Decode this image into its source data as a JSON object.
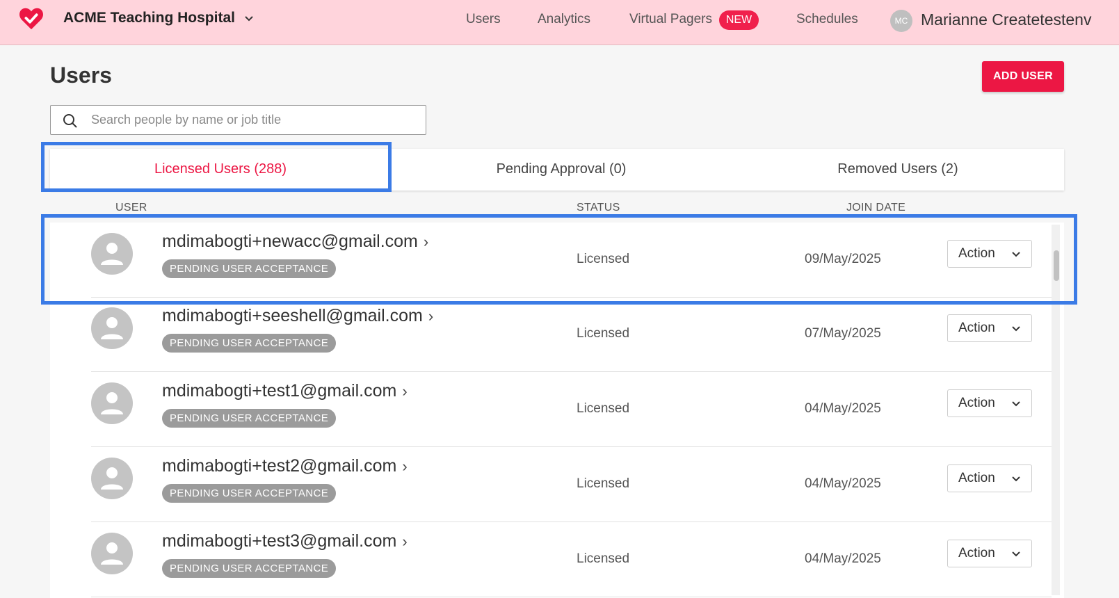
{
  "header": {
    "org_name": "ACME Teaching Hospital",
    "nav": [
      {
        "label": "Users"
      },
      {
        "label": "Analytics"
      },
      {
        "label": "Virtual Pagers",
        "badge": "NEW"
      },
      {
        "label": "Schedules"
      }
    ],
    "user_initials": "MC",
    "user_name": "Marianne Createtestenv"
  },
  "page": {
    "title": "Users",
    "add_user_label": "ADD USER",
    "search_placeholder": "Search people by name or job title",
    "search_value": ""
  },
  "tabs": [
    {
      "label": "Licensed Users (288)",
      "active": true
    },
    {
      "label": "Pending Approval (0)",
      "active": false
    },
    {
      "label": "Removed Users (2)",
      "active": false
    }
  ],
  "table": {
    "columns": [
      "USER",
      "STATUS",
      "JOIN DATE"
    ],
    "rows": [
      {
        "email": "mdimabogti+newacc@gmail.com",
        "badge": "PENDING USER ACCEPTANCE",
        "status": "Licensed",
        "join_date": "09/May/2025",
        "action": "Action"
      },
      {
        "email": "mdimabogti+seeshell@gmail.com",
        "badge": "PENDING USER ACCEPTANCE",
        "status": "Licensed",
        "join_date": "07/May/2025",
        "action": "Action"
      },
      {
        "email": "mdimabogti+test1@gmail.com",
        "badge": "PENDING USER ACCEPTANCE",
        "status": "Licensed",
        "join_date": "04/May/2025",
        "action": "Action"
      },
      {
        "email": "mdimabogti+test2@gmail.com",
        "badge": "PENDING USER ACCEPTANCE",
        "status": "Licensed",
        "join_date": "04/May/2025",
        "action": "Action"
      },
      {
        "email": "mdimabogti+test3@gmail.com",
        "badge": "PENDING USER ACCEPTANCE",
        "status": "Licensed",
        "join_date": "04/May/2025",
        "action": "Action"
      }
    ]
  },
  "colors": {
    "brand": "#ec1744",
    "topbar_bg": "#ffd4dc",
    "highlight": "#3b7be6",
    "badge_gray": "#9b9b9b"
  },
  "icons": [
    "heart-check-logo-icon",
    "chevron-down-icon",
    "search-icon",
    "user-avatar-icon",
    "chevron-right-icon"
  ]
}
